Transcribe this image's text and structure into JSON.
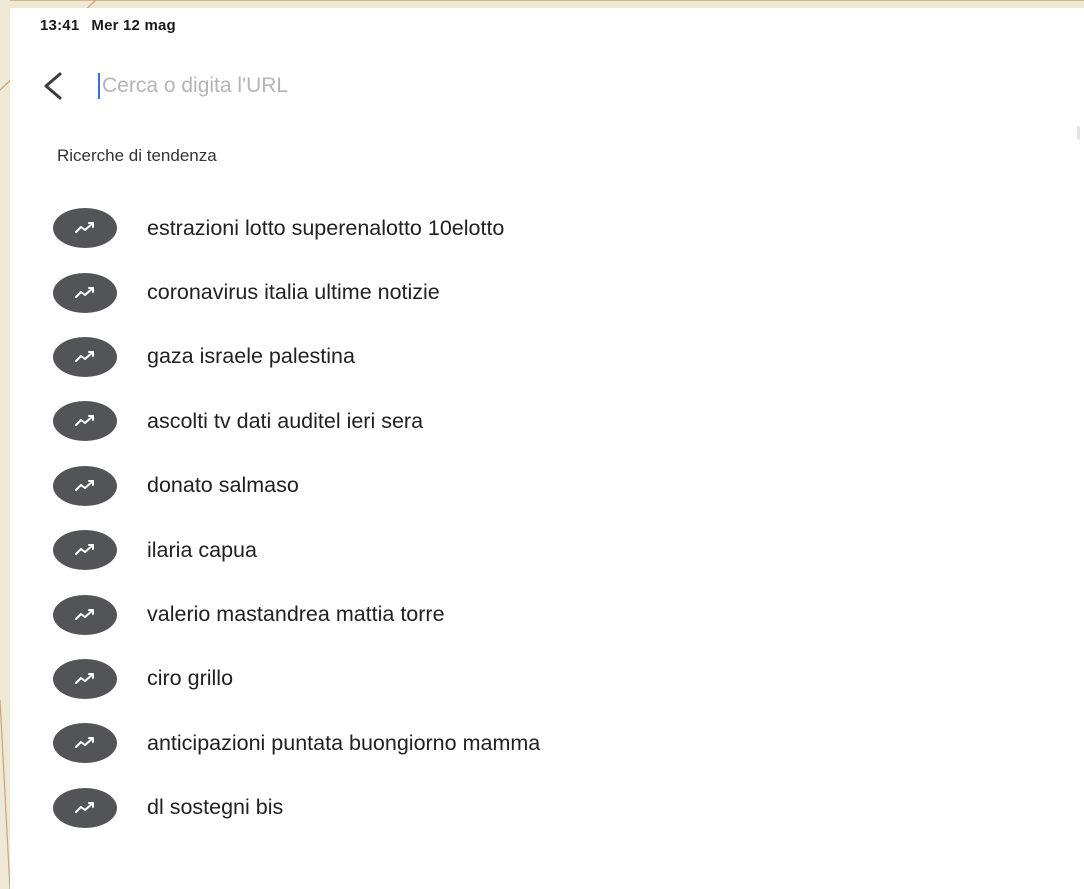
{
  "status_bar": {
    "time": "13:41",
    "date": "Mer 12 mag"
  },
  "search": {
    "back_icon": "chevron-left-icon",
    "placeholder": "Cerca o digita l'URL",
    "value": ""
  },
  "trending": {
    "title": "Ricerche di tendenza",
    "icon": "trending-up-icon",
    "items": [
      "estrazioni lotto superenalotto 10elotto",
      "coronavirus italia ultime notizie",
      "gaza israele palestina",
      "ascolti tv dati auditel ieri sera",
      "donato salmaso",
      "ilaria capua",
      "valerio mastandrea mattia torre",
      "ciro grillo",
      "anticipazioni puntata buongiorno mamma",
      "dl sostegni bis"
    ]
  },
  "colors": {
    "icon_background": "#535457",
    "cursor": "#3b6fd6",
    "slide_background": "#efe8d6"
  }
}
